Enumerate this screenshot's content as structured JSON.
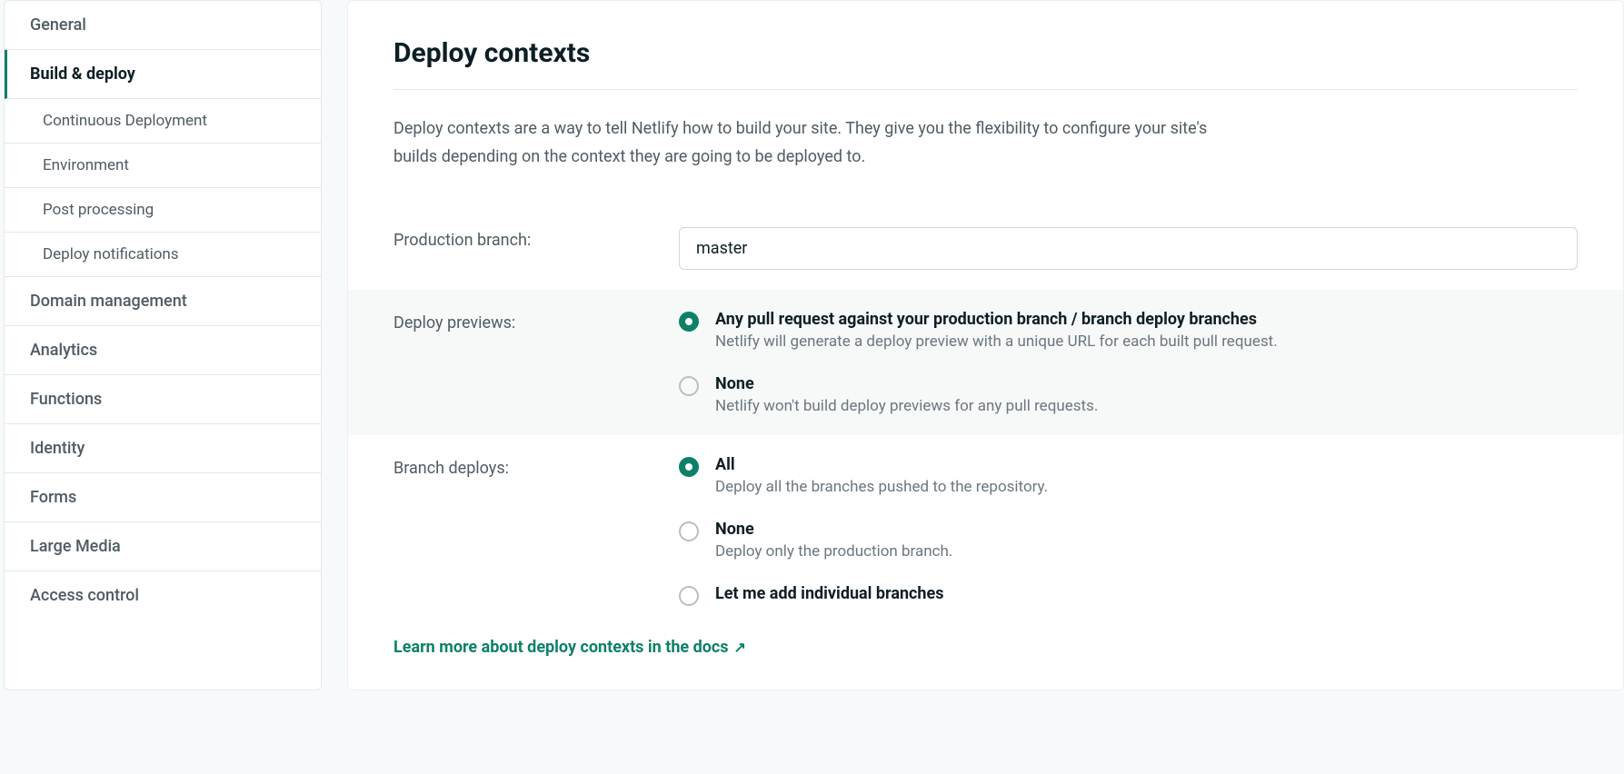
{
  "sidebar": {
    "items": [
      {
        "label": "General",
        "type": "item",
        "active": false
      },
      {
        "label": "Build & deploy",
        "type": "item",
        "active": true
      },
      {
        "label": "Continuous Deployment",
        "type": "sub"
      },
      {
        "label": "Environment",
        "type": "sub"
      },
      {
        "label": "Post processing",
        "type": "sub"
      },
      {
        "label": "Deploy notifications",
        "type": "sub"
      },
      {
        "label": "Domain management",
        "type": "item"
      },
      {
        "label": "Analytics",
        "type": "item"
      },
      {
        "label": "Functions",
        "type": "item"
      },
      {
        "label": "Identity",
        "type": "item"
      },
      {
        "label": "Forms",
        "type": "item"
      },
      {
        "label": "Large Media",
        "type": "item"
      },
      {
        "label": "Access control",
        "type": "item"
      }
    ]
  },
  "main": {
    "title": "Deploy contexts",
    "description": "Deploy contexts are a way to tell Netlify how to build your site. They give you the flexibility to configure your site's builds depending on the context they are going to be deployed to.",
    "production_branch_label": "Production branch:",
    "production_branch_value": "master",
    "deploy_previews_label": "Deploy previews:",
    "deploy_previews_options": [
      {
        "label": "Any pull request against your production branch / branch deploy branches",
        "help": "Netlify will generate a deploy preview with a unique URL for each built pull request.",
        "selected": true
      },
      {
        "label": "None",
        "help": "Netlify won't build deploy previews for any pull requests.",
        "selected": false
      }
    ],
    "branch_deploys_label": "Branch deploys:",
    "branch_deploys_options": [
      {
        "label": "All",
        "help": "Deploy all the branches pushed to the repository.",
        "selected": true
      },
      {
        "label": "None",
        "help": "Deploy only the production branch.",
        "selected": false
      },
      {
        "label": "Let me add individual branches",
        "help": "",
        "selected": false
      }
    ],
    "docs_link": "Learn more about deploy contexts in the docs"
  }
}
